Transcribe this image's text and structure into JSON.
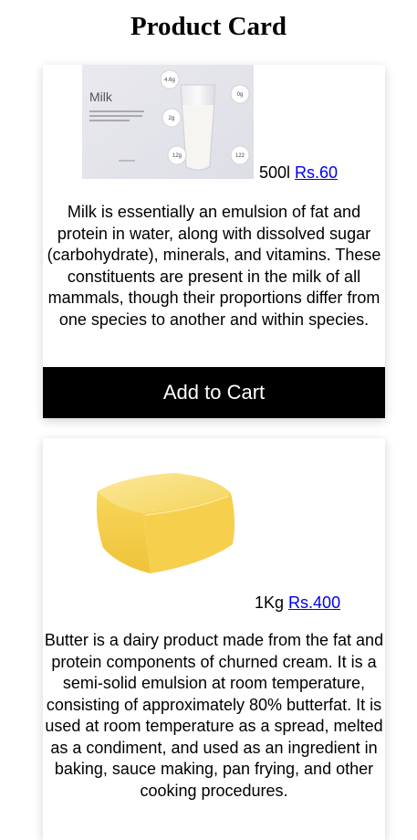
{
  "page": {
    "title": "Product Card"
  },
  "products": [
    {
      "name": "Milk",
      "image_label": "Milk",
      "quantity": "500l",
      "price": "Rs.60",
      "description": "Milk is essentially an emulsion of fat and protein in water, along with dissolved sugar (carbohydrate), minerals, and vitamins. These constituents are present in the milk of all mammals, though their proportions differ from one species to another and within species.",
      "button_label": "Add to Cart",
      "nutrition_badges": [
        "4.6g",
        "0g",
        "2g",
        "12g",
        "122"
      ]
    },
    {
      "name": "Butter",
      "quantity": "1Kg",
      "price": "Rs.400",
      "description": "Butter is a dairy product made from the fat and protein components of churned cream. It is a semi-solid emulsion at room temperature, consisting of approximately 80% butterfat. It is used at room temperature as a spread, melted as a condiment, and used as an ingredient in baking, sauce making, pan frying, and other cooking procedures."
    }
  ],
  "colors": {
    "link": "#0000ee",
    "button_bg": "#000000",
    "button_text": "#ffffff",
    "butter": "#f7d04a"
  }
}
